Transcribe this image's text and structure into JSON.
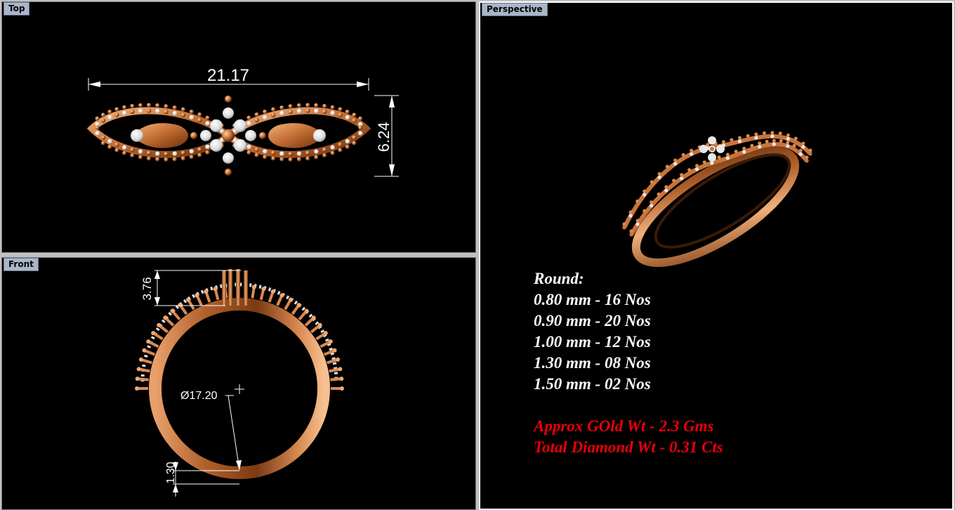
{
  "viewports": {
    "top": {
      "label": "Top"
    },
    "front": {
      "label": "Front"
    },
    "perspective": {
      "label": "Perspective"
    }
  },
  "dimensions": {
    "width": "21.17",
    "height": "6.24",
    "head_height": "3.76",
    "inner_diameter": "Ø17.20",
    "band_thickness": "1.30"
  },
  "specs": {
    "heading": "Round:",
    "stones": [
      "0.80 mm - 16 Nos",
      "0.90 mm - 20 Nos",
      "1.00 mm - 12 Nos",
      "1.30 mm - 08 Nos",
      "1.50 mm - 02 Nos"
    ],
    "gold_weight": "Approx GOld Wt - 2.3 Gms",
    "diamond_weight": "Total Diamond Wt - 0.31 Cts"
  },
  "colors": {
    "viewport_bg": "#000000",
    "gold": "#c9743a",
    "diamond": "#e8e8e8",
    "highlight_text": "#e8000a",
    "tab_bg": "#aab6c8"
  }
}
